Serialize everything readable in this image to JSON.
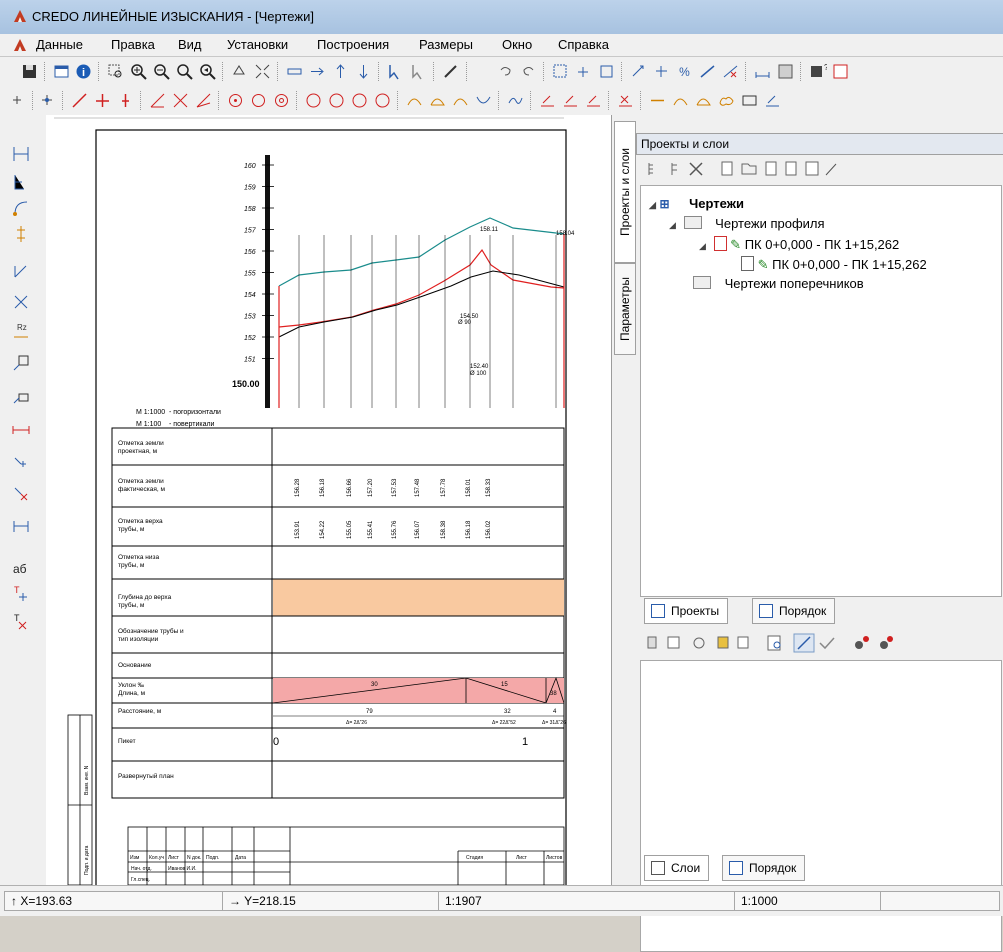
{
  "window": {
    "title": "CREDO ЛИНЕЙНЫЕ ИЗЫСКАНИЯ - [Чертежи]"
  },
  "menu": [
    "Данные",
    "Правка",
    "Вид",
    "Установки",
    "Построения",
    "Размеры",
    "Окно",
    "Справка"
  ],
  "side_tabs": {
    "projects_layers": "Проекты и слои",
    "parameters": "Параметры"
  },
  "panel": {
    "title": "Проекты и слои",
    "tree": {
      "root": "Чертежи",
      "profile_folder": "Чертежи профиля",
      "profile_item": "ПК 0+0,000 - ПК 1+15,262",
      "profile_subitem": "ПК 0+0,000 - ПК 1+15,262",
      "cross_folder": "Чертежи поперечников"
    },
    "tabs_top": {
      "projects": "Проекты",
      "order": "Порядок"
    },
    "tabs_bottom": {
      "layers": "Слои",
      "order": "Порядок"
    }
  },
  "drawing": {
    "scale_h": "М 1:1000",
    "scale_h_note": "- погоризонтали",
    "scale_v": "М 1:100",
    "scale_v_note": "- повертикали",
    "datum": "150.00",
    "elev_ticks": [
      "160",
      "159",
      "158",
      "157",
      "156",
      "155",
      "154",
      "153",
      "152",
      "151"
    ],
    "top_labels": [
      "158.11",
      "158.04"
    ],
    "pipe_labels": [
      "154.50",
      "Ø 90",
      "152.40",
      "Ø 100"
    ],
    "row_labels": [
      "Отметка земли проектная, м",
      "Отметка земли фактическая, м",
      "Отметка верха трубы, м",
      "Отметка низа трубы, м",
      "Глубина до верха трубы, м",
      "Обозначение трубы и тип изоляции",
      "Основание",
      "Уклон ‰ Длина, м",
      "Расстояние, м",
      "Пикет",
      "Развернутый план"
    ],
    "ground_values": [
      "156.28",
      "156.18",
      "156.66",
      "157.20",
      "157.53",
      "157.48",
      "157.78",
      "158.01",
      "158.33"
    ],
    "pipe_top_values": [
      "153.91",
      "154.22",
      "155.05",
      "155.41",
      "155.76",
      "156.07",
      "158.38",
      "156.18",
      "156.02"
    ],
    "slope_values": [
      "30",
      "15",
      "38"
    ],
    "length_values": [
      "79",
      "32",
      "4"
    ],
    "distance_labels": [
      "Δ= 2Δ“26",
      "Δ= 22Δ“52",
      "Δ= 31Δ“26"
    ],
    "picket_values": [
      "0",
      "1"
    ],
    "side_stamp": [
      "Взам. инв. N",
      "Подп. и дата",
      "Инв. N подл."
    ],
    "stamp_headers": [
      "Изм",
      "Кол.уч",
      "Лист",
      "N док.",
      "Подп.",
      "Дата"
    ],
    "stamp_row": [
      "Нач. отд.",
      "Иванов И.И."
    ],
    "stamp_right": [
      "Стадия",
      "Лист",
      "Листов"
    ],
    "stamp_partial": "Гл.спец."
  },
  "status": {
    "x": "↑ X=193.63",
    "y": "→ Y=218.15",
    "scale1": "1:1907",
    "scale2": "1:1000"
  },
  "colors": {
    "ground_line": "#1a8c8c",
    "design_line": "#e02020",
    "depth_fill": "#f9c9a0",
    "slope_fill": "#f4a8a8",
    "selection": "#d03030"
  }
}
